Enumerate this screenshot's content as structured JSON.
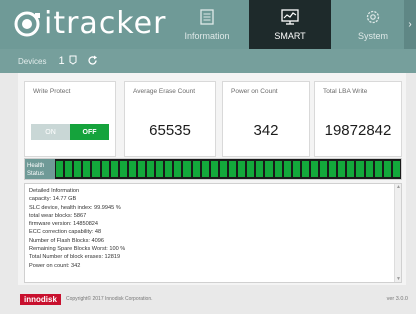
{
  "app": {
    "logo_text": "itracker"
  },
  "tabs": [
    {
      "label": "Information",
      "icon": "document-icon"
    },
    {
      "label": "SMART",
      "icon": "monitor-chart-icon"
    },
    {
      "label": "System",
      "icon": "gear-icon"
    }
  ],
  "devices": {
    "label": "Devices",
    "count": "1",
    "refresh_icon": "refresh-icon"
  },
  "cards": {
    "write_protect": {
      "title": "Write Protect",
      "on_label": "ON",
      "off_label": "OFF",
      "state": "OFF"
    },
    "erase": {
      "title": "Average Erase Count",
      "value": "65535"
    },
    "power": {
      "title": "Power on Count",
      "value": "342"
    },
    "lba": {
      "title": "Total LBA Write",
      "value": "19872842"
    }
  },
  "health": {
    "label": "Health Status",
    "level": 1.0,
    "color": "#13a83b"
  },
  "detail": {
    "lines": [
      "Detailed Information",
      "capacity: 14.77 GB",
      "SLC device, health index: 99.9945 %",
      "total wear blocks: 5867",
      "firmware version: 14850824",
      "ECC correction capability: 48",
      "Number of Flash Blocks: 4096",
      "Remaining Spare Blocks Worst: 100 %",
      "Total Number of block erases: 12819",
      "Power on count: 342"
    ]
  },
  "footer": {
    "brand": "innodisk",
    "copyright": "Copyright© 2017 Innodisk Corporation.",
    "version": "ver 3.0.0"
  },
  "colors": {
    "accent": "#6f9a97",
    "active_tab": "#1e2a2b",
    "on_green": "#15a33c"
  }
}
